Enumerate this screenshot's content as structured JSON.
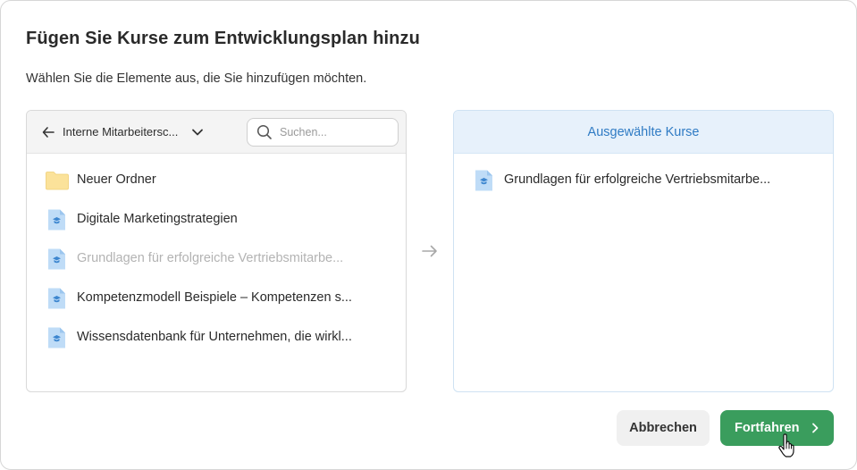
{
  "dialog": {
    "title": "Fügen Sie Kurse zum Entwicklungsplan hinzu",
    "subtitle": "Wählen Sie die Elemente aus, die Sie hinzufügen möchten."
  },
  "source": {
    "label": "Interne Mitarbeitersc...",
    "back_icon": "arrow-left-icon",
    "dropdown_icon": "chevron-down-icon"
  },
  "search": {
    "placeholder": "Suchen...",
    "value": ""
  },
  "items": [
    {
      "label": "Neuer Ordner",
      "type": "folder",
      "disabled": false
    },
    {
      "label": "Digitale Marketingstrategien",
      "type": "course",
      "disabled": false
    },
    {
      "label": "Grundlagen für erfolgreiche Vertriebsmitarbe...",
      "type": "course",
      "disabled": true
    },
    {
      "label": "Kompetenzmodell Beispiele – Kompetenzen s...",
      "type": "course",
      "disabled": false
    },
    {
      "label": "Wissensdatenbank für Unternehmen, die wirkl...",
      "type": "course",
      "disabled": false
    }
  ],
  "selected": {
    "header": "Ausgewählte Kurse",
    "items": [
      {
        "label": "Grundlagen für erfolgreiche Vertriebsmitarbe...",
        "type": "course"
      }
    ]
  },
  "buttons": {
    "cancel": "Abbrechen",
    "continue": "Fortfahren"
  },
  "colors": {
    "accent_green": "#3a9d5d",
    "accent_blue": "#2f7bc4",
    "folder_yellow": "#fbe29a",
    "course_blue": "#bfdcf7"
  }
}
